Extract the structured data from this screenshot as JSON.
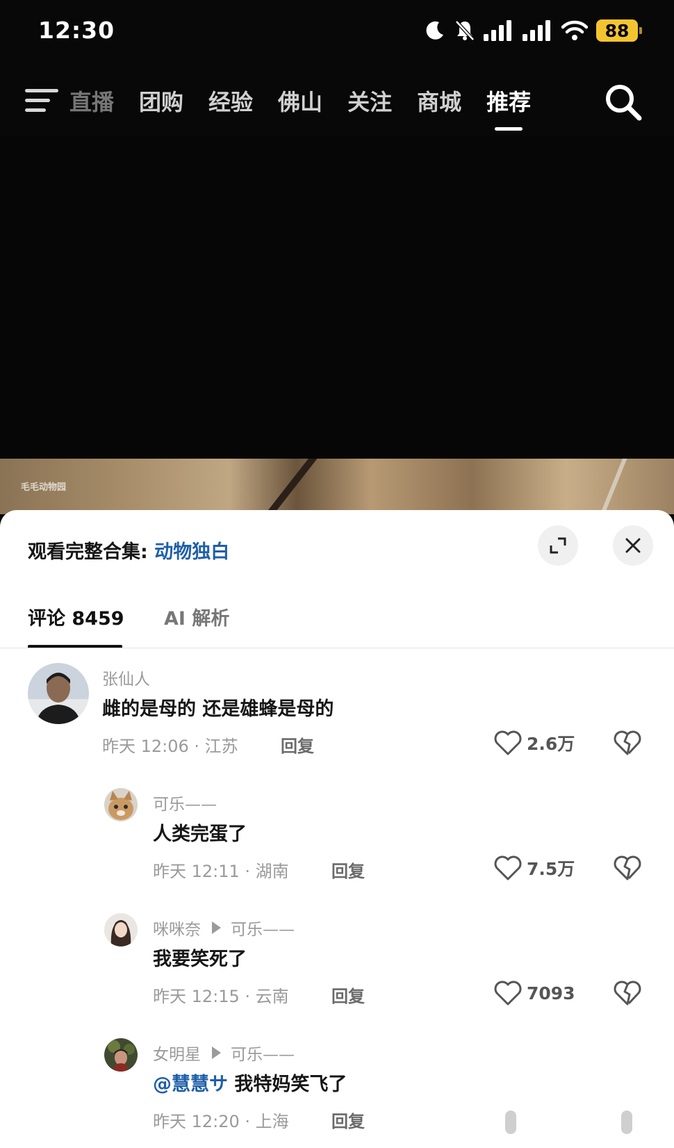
{
  "status_bar": {
    "time": "12:30",
    "battery": "88",
    "icons": [
      "moon-icon",
      "mute-bell-icon",
      "signal-icon",
      "signal-icon",
      "wifi-icon",
      "battery-icon"
    ]
  },
  "nav": {
    "tabs": [
      "直播",
      "团购",
      "经验",
      "佛山",
      "关注",
      "商城",
      "推荐"
    ],
    "active_tab": "推荐"
  },
  "video": {
    "watermark": "毛毛动物园"
  },
  "sheet": {
    "collection_prefix": "观看完整合集: ",
    "collection_name": "动物独白",
    "tabs": {
      "comments": "评论 8459",
      "ai": "AI 解析"
    }
  },
  "comments": [
    {
      "author": "张仙人",
      "text": "雌的是母的 还是雄蜂是母的",
      "meta": "昨天 12:06 · 江苏",
      "reply": "回复",
      "likes": "2.6万"
    },
    {
      "author": "可乐——",
      "text": "人类完蛋了",
      "meta": "昨天 12:11 · 湖南",
      "reply": "回复",
      "likes": "7.5万"
    },
    {
      "author": "咪咪奈",
      "reply_to": "可乐——",
      "text": "我要笑死了",
      "meta": "昨天 12:15 · 云南",
      "reply": "回复",
      "likes": "7093"
    },
    {
      "author": "女明星",
      "reply_to": "可乐——",
      "mention": "@慧慧サ",
      "text": " 我特妈笑飞了",
      "meta": "昨天 12:20 · 上海",
      "reply": "回复"
    }
  ],
  "colors": {
    "accent_link": "#1f5fa8",
    "battery": "#f4c430",
    "background": "#080808"
  }
}
